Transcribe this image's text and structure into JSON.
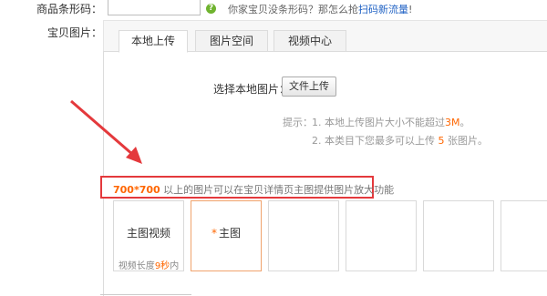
{
  "barcode": {
    "label": "商品条形码：",
    "input_value": "",
    "hint_text": "你家宝贝没条形码？那怎么抢",
    "hint_link": "扫码新流量",
    "hint_end": "!"
  },
  "images": {
    "label": "宝贝图片：",
    "required_mark": "*"
  },
  "tabs": [
    {
      "label": "本地上传",
      "active": true
    },
    {
      "label": "图片空间",
      "active": false
    },
    {
      "label": "视频中心",
      "active": false
    }
  ],
  "upload": {
    "choose_label": "选择本地图片：",
    "button_label": "文件上传"
  },
  "tips": {
    "label": "提示：",
    "line1_prefix": "1. 本地上传图片大小不能超过",
    "line1_highlight": "3M",
    "line1_suffix": "。",
    "line2_prefix": "2. 本类目下您最多可以上传 ",
    "line2_highlight": "5",
    "line2_suffix": " 张图片。"
  },
  "size_note": {
    "highlight": "700*700",
    "text": " 以上的图片可以在宝贝详情页主图提供图片放大功能"
  },
  "slots": {
    "video_title": "主图视频",
    "video_sub_prefix": "视频长度",
    "video_sub_highlight": "9秒",
    "video_sub_suffix": "内",
    "main_star": "*",
    "main_title": "主图"
  },
  "colors": {
    "accent": "#ff6600",
    "annotation_red": "#e4393c",
    "link": "#2062c4"
  }
}
